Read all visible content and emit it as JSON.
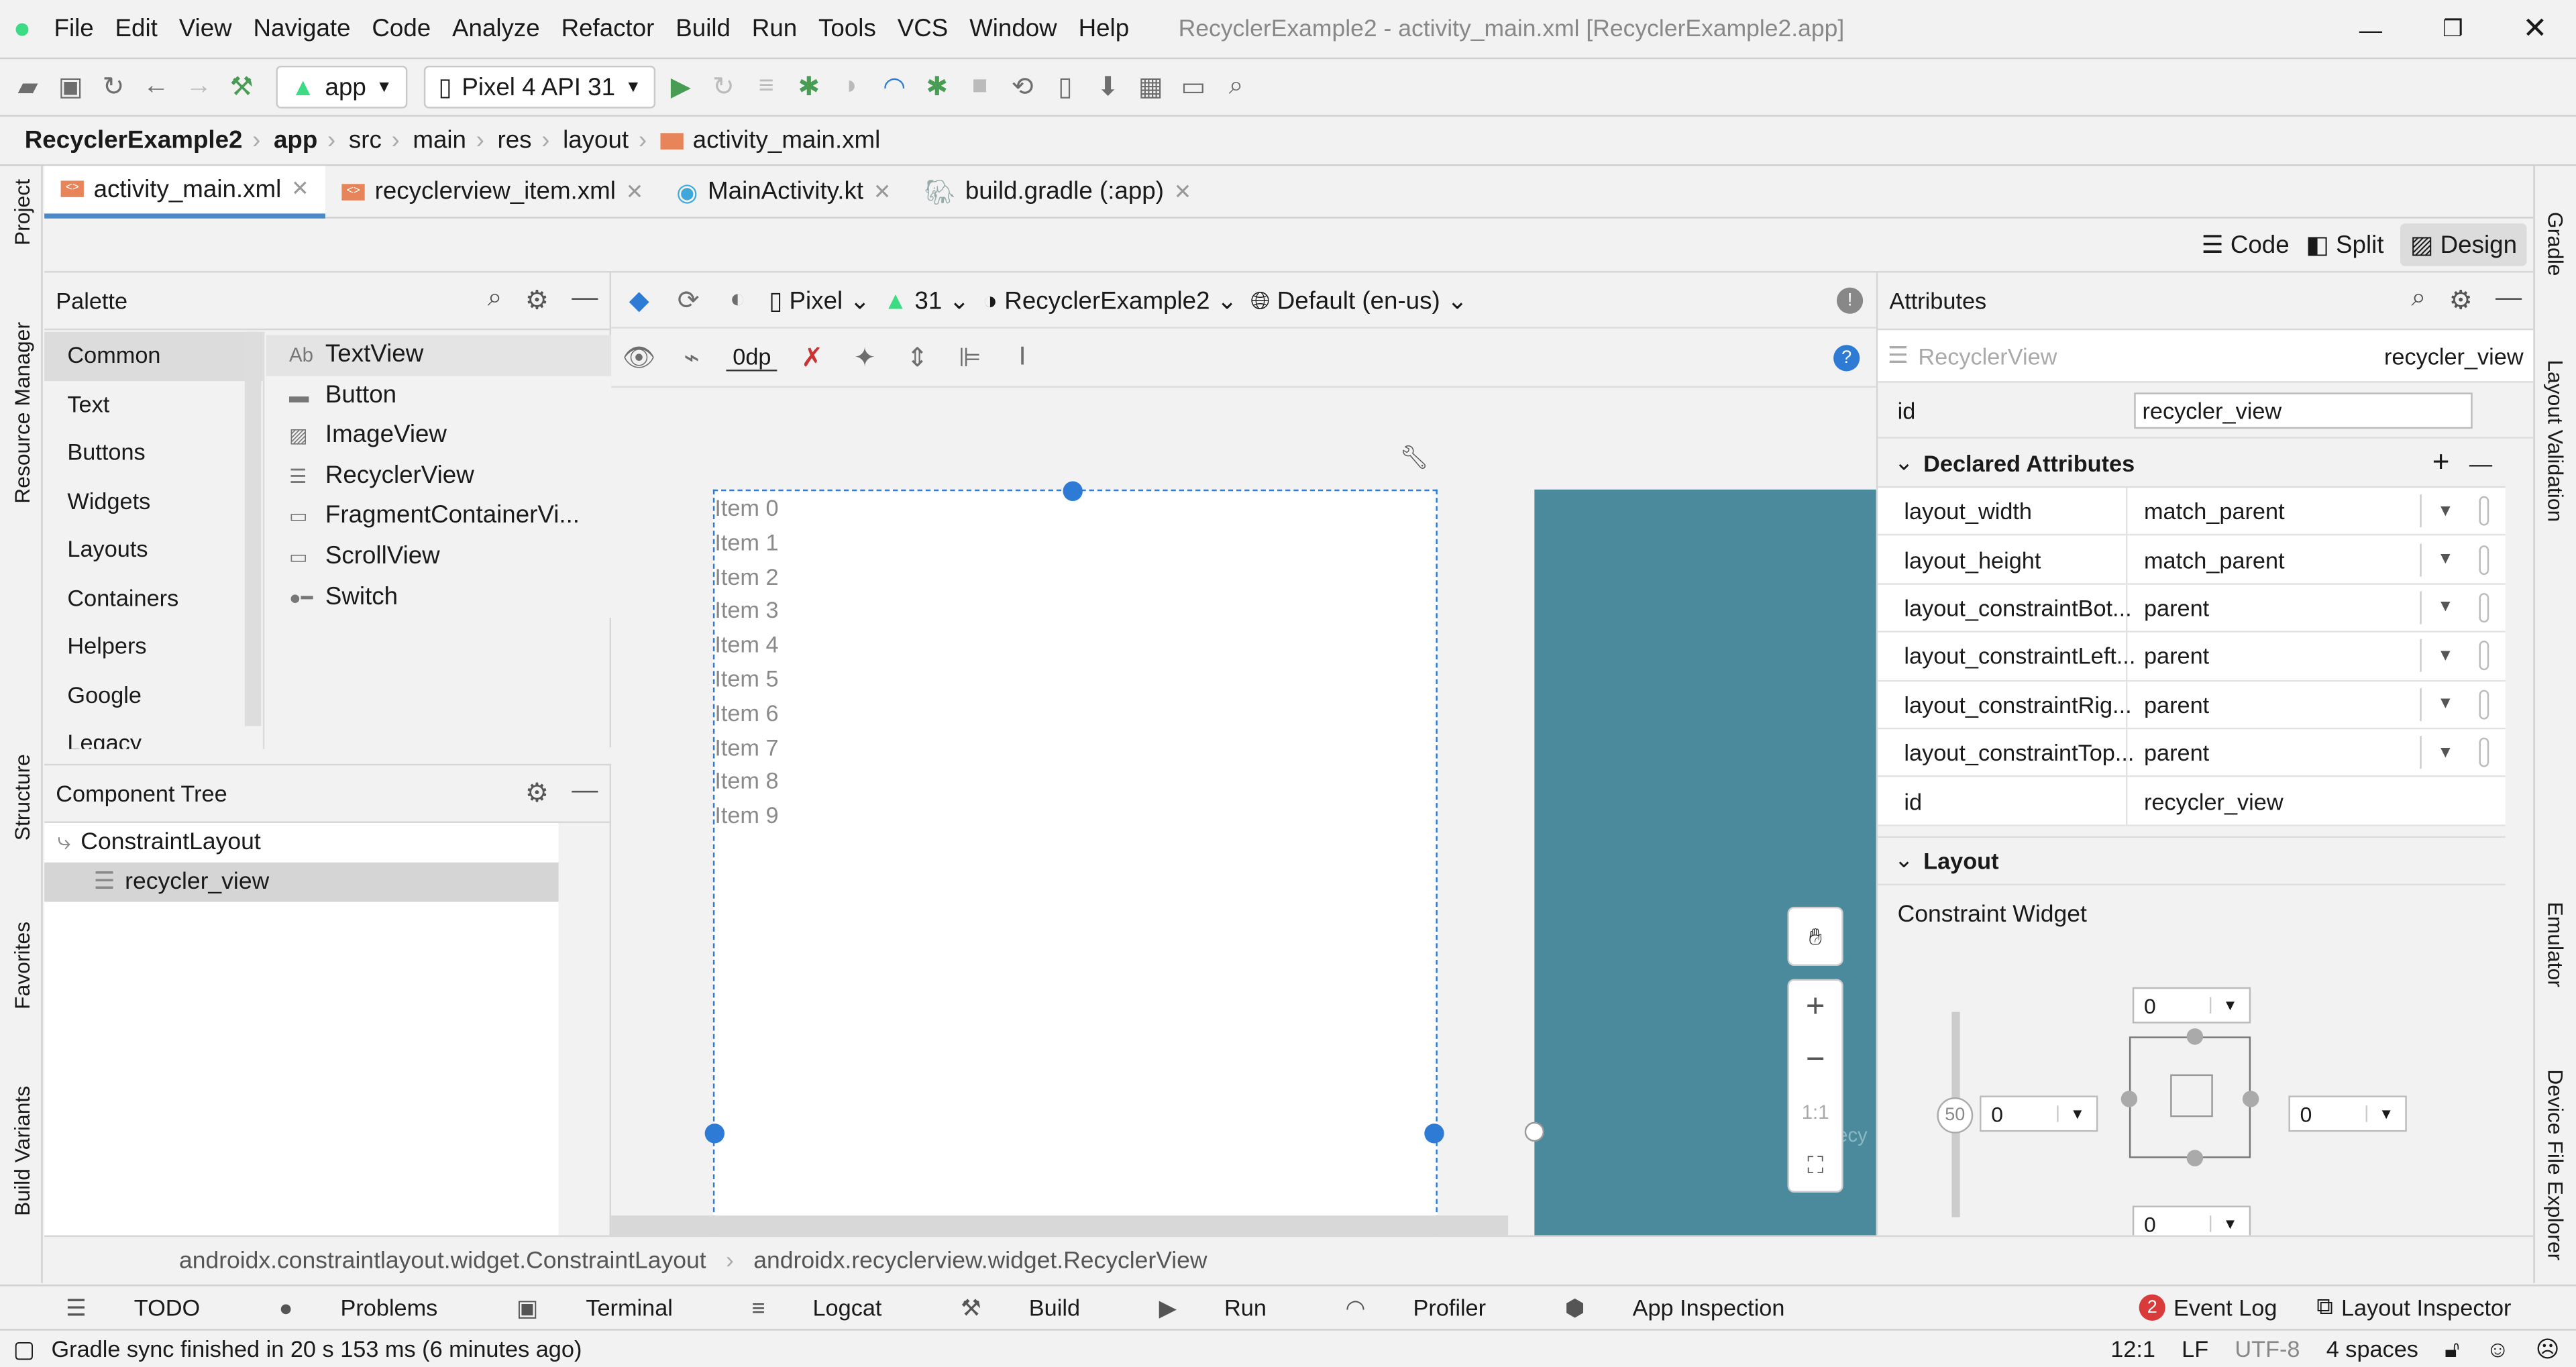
{
  "window_title": "RecyclerExample2 - activity_main.xml [RecyclerExample2.app]",
  "menu": [
    "File",
    "Edit",
    "View",
    "Navigate",
    "Code",
    "Analyze",
    "Refactor",
    "Build",
    "Run",
    "Tools",
    "VCS",
    "Window",
    "Help"
  ],
  "toolbar": {
    "run_config": "app",
    "device": "Pixel 4 API 31"
  },
  "breadcrumb": [
    "RecyclerExample2",
    "app",
    "src",
    "main",
    "res",
    "layout",
    "activity_main.xml"
  ],
  "tabs": [
    {
      "label": "activity_main.xml",
      "active": true
    },
    {
      "label": "recyclerview_item.xml"
    },
    {
      "label": "MainActivity.kt"
    },
    {
      "label": "build.gradle (:app)"
    }
  ],
  "view_modes": {
    "code": "Code",
    "split": "Split",
    "design": "Design"
  },
  "left_strip": [
    "Project",
    "Resource Manager",
    "Structure",
    "Favorites",
    "Build Variants"
  ],
  "right_strip": [
    "Gradle",
    "Layout Validation",
    "Emulator",
    "Device File Explorer"
  ],
  "palette": {
    "title": "Palette",
    "categories": [
      "Common",
      "Text",
      "Buttons",
      "Widgets",
      "Layouts",
      "Containers",
      "Helpers",
      "Google",
      "Legacy"
    ],
    "items": [
      {
        "icon": "Ab",
        "label": "TextView"
      },
      {
        "icon": "▬",
        "label": "Button"
      },
      {
        "icon": "▨",
        "label": "ImageView"
      },
      {
        "icon": "☰",
        "label": "RecyclerView"
      },
      {
        "icon": "▭",
        "label": "FragmentContainerVi..."
      },
      {
        "icon": "▭",
        "label": "ScrollView"
      },
      {
        "icon": "●━",
        "label": "Switch"
      }
    ]
  },
  "component_tree": {
    "title": "Component Tree",
    "nodes": [
      "ConstraintLayout",
      "recycler_view"
    ]
  },
  "design_toolbar": {
    "device": "Pixel",
    "api": "31",
    "theme": "RecyclerExample2",
    "locale": "Default (en-us)",
    "margin": "0dp"
  },
  "canvas": {
    "items": [
      "Item 0",
      "Item 1",
      "Item 2",
      "Item 3",
      "Item 4",
      "Item 5",
      "Item 6",
      "Item 7",
      "Item 8",
      "Item 9"
    ],
    "blueprint_color": "#4a8a9c",
    "zoom_reset": "1:1",
    "blueprint_label": "ecy"
  },
  "attributes": {
    "title": "Attributes",
    "component_type": "RecyclerView",
    "component_id": "recycler_view",
    "id_label": "id",
    "id_value": "recycler_view",
    "declared_title": "Declared Attributes",
    "declared": [
      {
        "k": "layout_width",
        "v": "match_parent"
      },
      {
        "k": "layout_height",
        "v": "match_parent"
      },
      {
        "k": "layout_constraintBot...",
        "v": "parent"
      },
      {
        "k": "layout_constraintLeft...",
        "v": "parent"
      },
      {
        "k": "layout_constraintRig...",
        "v": "parent"
      },
      {
        "k": "layout_constraintTop...",
        "v": "parent"
      }
    ],
    "declared_id": {
      "k": "id",
      "v": "recycler_view"
    },
    "layout_title": "Layout",
    "constraint_widget": "Constraint Widget",
    "margins": {
      "top": "0",
      "left": "0",
      "right": "0",
      "bottom": "0",
      "bias": "50"
    }
  },
  "bottom_path": [
    "androidx.constraintlayout.widget.ConstraintLayout",
    "androidx.recyclerview.widget.RecyclerView"
  ],
  "tool_windows": [
    "TODO",
    "Problems",
    "Terminal",
    "Logcat",
    "Build",
    "Run",
    "Profiler",
    "App Inspection"
  ],
  "tool_windows_right": {
    "event_log": "Event Log",
    "event_count": "2",
    "layout_inspector": "Layout Inspector"
  },
  "status": {
    "message": "Gradle sync finished in 20 s 153 ms (6 minutes ago)",
    "position": "12:1",
    "line_sep": "LF",
    "encoding": "UTF-8",
    "indent": "4 spaces"
  },
  "colors": {
    "android_green": "#3ddc84",
    "accent_blue": "#2e7bd6",
    "run_green": "#499c54"
  }
}
